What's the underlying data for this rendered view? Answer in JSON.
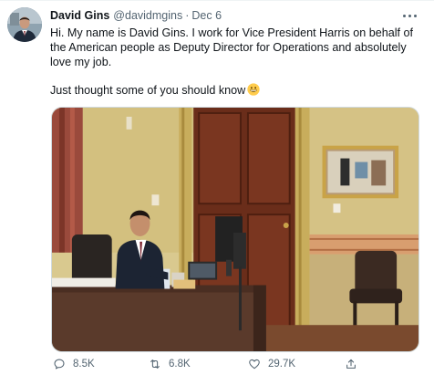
{
  "tweet": {
    "author_name": "David Gins",
    "handle": "@davidmgins",
    "separator": "·",
    "date": "Dec 6",
    "text_paragraph_1": "Hi. My name is David Gins. I work for Vice President Harris on behalf of the American people as Deputy Director for Operations and absolutely love my job.",
    "text_paragraph_2": "Just thought some of you should know",
    "emoji": "grinning-face-emoji"
  },
  "media": {
    "image_icon": "photo-office-desk"
  },
  "actions": {
    "reply_icon": "reply-icon",
    "reply_count": "8.5K",
    "retweet_icon": "retweet-icon",
    "retweet_count": "6.8K",
    "like_icon": "heart-icon",
    "like_count": "29.7K",
    "share_icon": "share-icon"
  },
  "colors": {
    "text_primary": "#0f1419",
    "text_secondary": "#536471",
    "border": "#cfd9de"
  }
}
